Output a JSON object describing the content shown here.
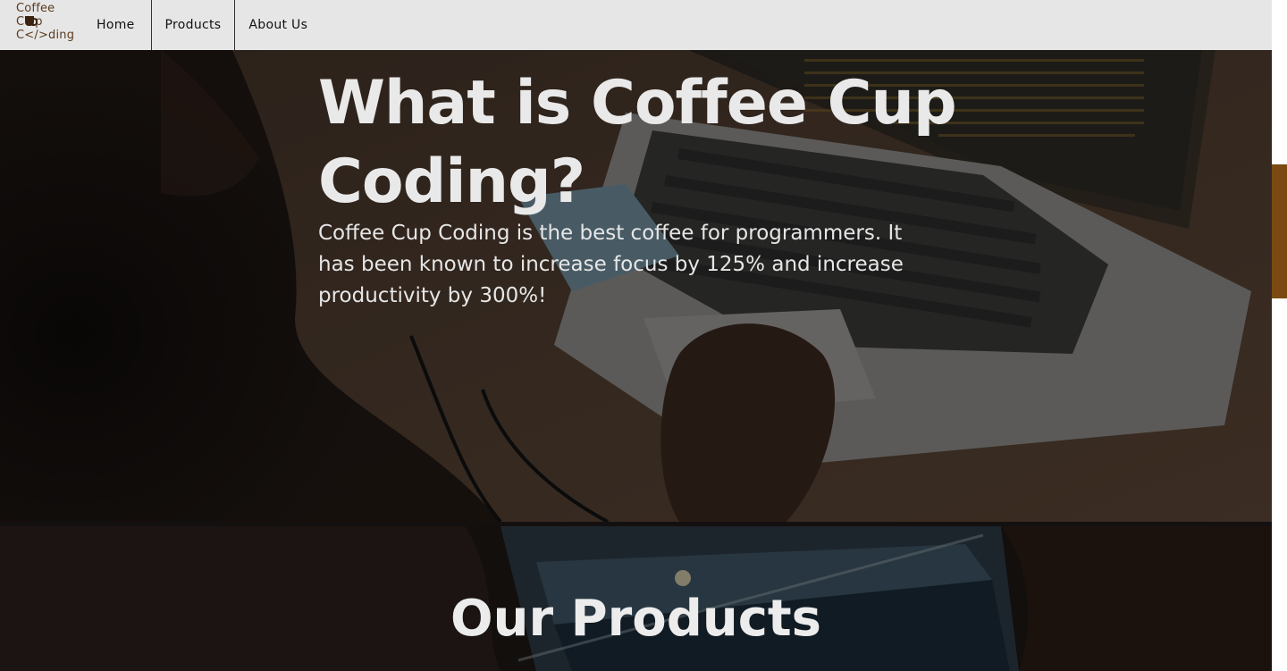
{
  "logo": {
    "line1": "Coffee",
    "line2_a": "C",
    "line2_b": "p",
    "line3": "C</>ding"
  },
  "nav": {
    "home": "Home",
    "products": "Products",
    "about": "About Us"
  },
  "hero": {
    "title": "What is Coffee Cup Coding?",
    "description": "Coffee Cup Coding is the best coffee for programmers. It has been known to increase focus by 125% and increase productivity by 300%!"
  },
  "products": {
    "title": "Our Products"
  },
  "colors": {
    "nav_bg": "#e6e6e6",
    "brand_brown": "#5b3a1e",
    "scrollbar_thumb": "#7a4a12",
    "heading_text": "#e9e9e9"
  },
  "icons": {
    "logo_cup": "coffee-cup-icon"
  }
}
